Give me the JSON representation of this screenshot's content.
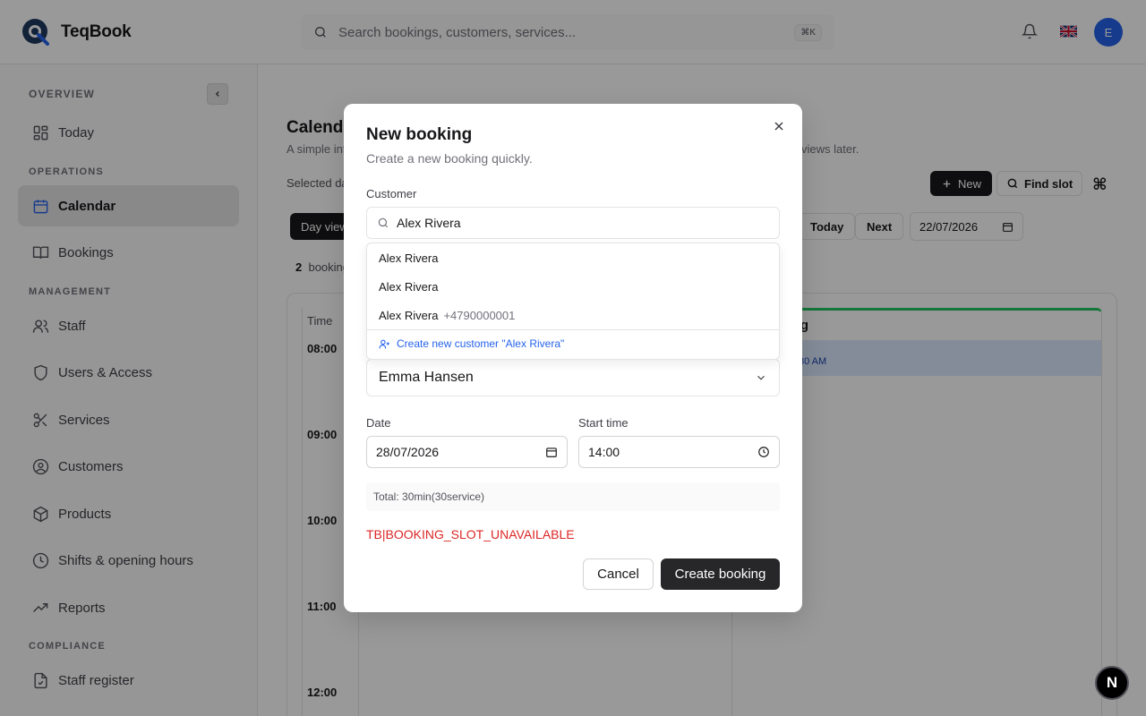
{
  "app": {
    "name": "TeqBook",
    "avatar_initial": "E",
    "flag": "UK flag"
  },
  "search": {
    "placeholder": "Search bookings, customers, services...",
    "shortcut": "⌘K"
  },
  "sidebar": {
    "sections": {
      "overview": "OVERVIEW",
      "operations": "OPERATIONS",
      "management": "MANAGEMENT",
      "compliance": "COMPLIANCE"
    },
    "items": [
      {
        "label": "Today",
        "icon": "grid-icon"
      },
      {
        "label": "Calendar",
        "icon": "calendar-icon",
        "active": true
      },
      {
        "label": "Bookings",
        "icon": "book-icon"
      },
      {
        "label": "Staff",
        "icon": "users-icon"
      },
      {
        "label": "Users & Access",
        "icon": "shield-icon"
      },
      {
        "label": "Services",
        "icon": "scissors-icon"
      },
      {
        "label": "Customers",
        "icon": "user-circle-icon"
      },
      {
        "label": "Products",
        "icon": "package-icon"
      },
      {
        "label": "Shifts & opening hours",
        "icon": "clock-icon"
      },
      {
        "label": "Reports",
        "icon": "trend-icon"
      },
      {
        "label": "Staff register",
        "icon": "file-check-icon"
      }
    ]
  },
  "main": {
    "title": "Calenda",
    "subtitle": "A simple int",
    "subtitle_tail": "views later.",
    "selected_date_label": "Selected da",
    "new_label": "New",
    "find_slot_label": "Find slot",
    "day_view_label": "Day view",
    "today_label": "Today",
    "next_label": "Next",
    "date_value": "22/07/2026",
    "bookings_count": "2",
    "bookings_label": "booking",
    "time_header": "Time",
    "hours": [
      "08:00",
      "09:00",
      "10:00",
      "11:00",
      "12:00"
    ],
    "staff_name": "rg",
    "booking_time": "30 AM"
  },
  "modal": {
    "title": "New booking",
    "subtitle": "Create a new booking quickly.",
    "customer_label": "Customer",
    "customer_value": "Alex Rivera",
    "suggestions": [
      {
        "name": "Alex Rivera",
        "phone": ""
      },
      {
        "name": "Alex Rivera",
        "phone": ""
      },
      {
        "name": "Alex Rivera",
        "phone": "+4790000001"
      }
    ],
    "create_new": "Create new customer \"Alex Rivera\"",
    "staff_value": "Emma Hansen",
    "date_label": "Date",
    "date_value": "28/07/2026",
    "start_time_label": "Start time",
    "start_time_value": "14:00",
    "total": "Total: 30min(30service)",
    "error": "TB|BOOKING_SLOT_UNAVAILABLE",
    "cancel_label": "Cancel",
    "create_label": "Create booking"
  },
  "badge": "N"
}
